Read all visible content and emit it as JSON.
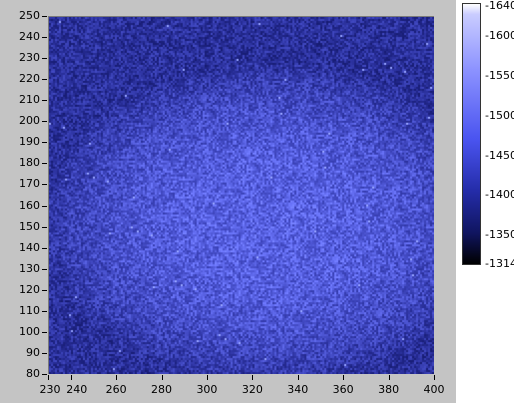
{
  "graph": {
    "y_ticks": [
      "250",
      "240",
      "230",
      "220",
      "210",
      "200",
      "190",
      "180",
      "170",
      "160",
      "150",
      "140",
      "130",
      "120",
      "110",
      "100",
      "90",
      "80"
    ],
    "x_ticks": [
      "230",
      "240",
      "260",
      "280",
      "300",
      "320",
      "340",
      "360",
      "380",
      "400"
    ],
    "x_range": [
      230,
      400
    ],
    "y_range": [
      80,
      250
    ],
    "spot": {
      "center_x": 327,
      "center_y": 152,
      "radius_x": 82,
      "radius_y": 62
    }
  },
  "color_ramp": {
    "labels": [
      "1640",
      "1600",
      "1550",
      "1500",
      "1450",
      "1400",
      "1350",
      "1314"
    ],
    "min": 1314,
    "max": 1640,
    "colors": {
      "low": "#000000",
      "mid": "#4a54f0",
      "high": "#ffffff",
      "background": "#1b2590"
    }
  }
}
